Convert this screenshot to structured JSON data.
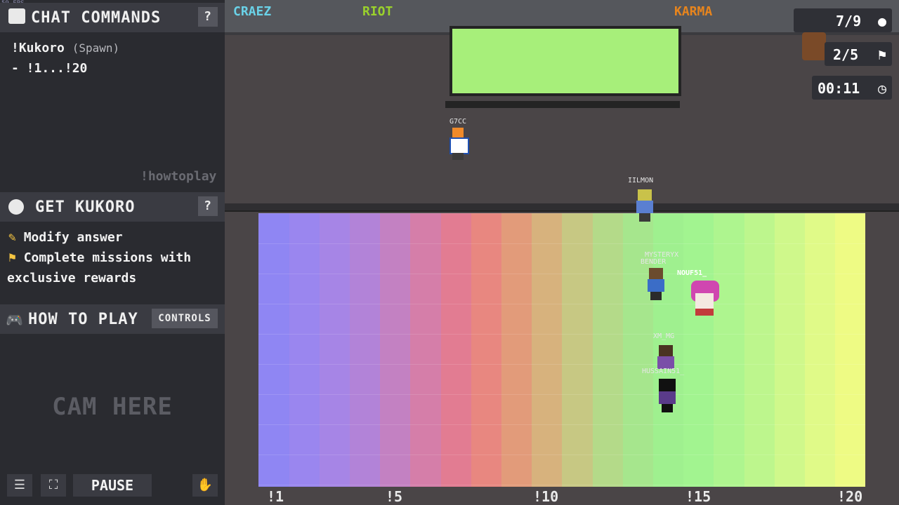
{
  "overlay": {
    "fps": "59 FPS"
  },
  "chat_commands": {
    "title": "CHAT COMMANDS",
    "help": "?",
    "cmd_name": "!Kukoro",
    "cmd_type": "(Spawn)",
    "cmd_range": "- !1...!20",
    "watermark": "!howtoplay"
  },
  "get_kukoro": {
    "title": "GET KUKORO",
    "help": "?",
    "features": [
      "Modify answer",
      "Complete missions with",
      "exclusive rewards"
    ]
  },
  "how_to_play": {
    "title": "HOW TO PLAY",
    "controls_label": "CONTROLS",
    "cam_text": "CAM HERE"
  },
  "bottom_bar": {
    "pause_label": "PAUSE"
  },
  "stats": {
    "players": "7/9",
    "round": "2/5",
    "timer": "00:11"
  },
  "floor": {
    "tick_labels": [
      "!1",
      "!5",
      "!10",
      "!15",
      "!20"
    ],
    "column_colors": [
      "#8f86f3",
      "#9a86ef",
      "#a685e6",
      "#b283d8",
      "#c381c2",
      "#d57ea9",
      "#e27c92",
      "#e88780",
      "#e29b7a",
      "#d7b27d",
      "#c7c883",
      "#b4da89",
      "#a6e68d",
      "#9ff08f",
      "#a2f490",
      "#aef58f",
      "#bdf68d",
      "#cff88b",
      "#e0fa88",
      "#eefb84"
    ]
  },
  "players": [
    {
      "name": "G7CC"
    },
    {
      "name": "IILMON"
    },
    {
      "name": "MYSTERYX"
    },
    {
      "name": "BENDER"
    },
    {
      "name": "NOUF51_"
    },
    {
      "name": "XM_MG"
    },
    {
      "name": "HUSSAIN51_"
    }
  ],
  "graffiti": [
    "CRAEZ",
    "RIOT",
    "KARMA"
  ]
}
